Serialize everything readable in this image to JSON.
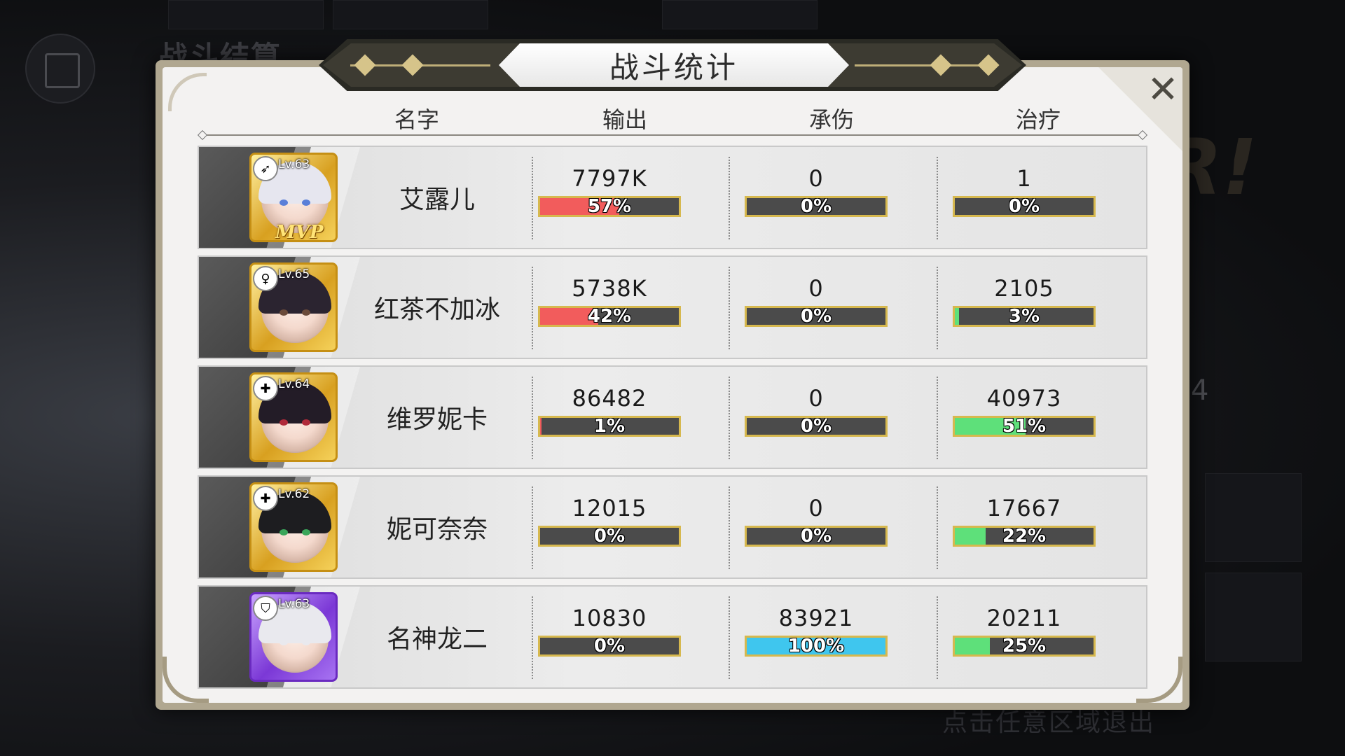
{
  "background": {
    "screen_title": "战斗结算",
    "exit_hint": "点击任意区域退出",
    "side_number": "4"
  },
  "dialog": {
    "title": "战斗统计",
    "close_icon": "close-icon",
    "columns": {
      "name": "名字",
      "damage": "输出",
      "tank": "承伤",
      "heal": "治疗"
    },
    "colors": {
      "damage": "#f25c5c",
      "tank": "#3fc6ee",
      "heal": "#5ee07a",
      "bar_bg": "#4b4b4b",
      "bar_border": "#d6b84e"
    }
  },
  "rows": [
    {
      "name": "艾露儿",
      "level": "Lv.63",
      "frame": "gold",
      "role_icon": "archer-icon",
      "mvp": "MVP",
      "damage": {
        "value": "7797K",
        "pct": "57%",
        "frac": 0.57
      },
      "tank": {
        "value": "0",
        "pct": "0%",
        "frac": 0
      },
      "heal": {
        "value": "1",
        "pct": "0%",
        "frac": 0
      },
      "hair": "#e6e6ef",
      "eye": "#5a7fd8"
    },
    {
      "name": "红茶不加冰",
      "level": "Lv.65",
      "frame": "gold",
      "role_icon": "mage-icon",
      "mvp": "",
      "damage": {
        "value": "5738K",
        "pct": "42%",
        "frac": 0.42
      },
      "tank": {
        "value": "0",
        "pct": "0%",
        "frac": 0
      },
      "heal": {
        "value": "2105",
        "pct": "3%",
        "frac": 0.03
      },
      "hair": "#2b2430",
      "eye": "#6a4a3a"
    },
    {
      "name": "维罗妮卡",
      "level": "Lv.64",
      "frame": "gold",
      "role_icon": "healer-icon",
      "mvp": "",
      "damage": {
        "value": "86482",
        "pct": "1%",
        "frac": 0.01
      },
      "tank": {
        "value": "0",
        "pct": "0%",
        "frac": 0
      },
      "heal": {
        "value": "40973",
        "pct": "51%",
        "frac": 0.51
      },
      "hair": "#231c27",
      "eye": "#b02a3a"
    },
    {
      "name": "妮可奈奈",
      "level": "Lv.62",
      "frame": "gold",
      "role_icon": "healer-icon",
      "mvp": "",
      "damage": {
        "value": "12015",
        "pct": "0%",
        "frac": 0
      },
      "tank": {
        "value": "0",
        "pct": "0%",
        "frac": 0
      },
      "heal": {
        "value": "17667",
        "pct": "22%",
        "frac": 0.22
      },
      "hair": "#1d1d20",
      "eye": "#3aa65a"
    },
    {
      "name": "名神龙二",
      "level": "Lv.63",
      "frame": "purple",
      "role_icon": "shield-icon",
      "mvp": "",
      "damage": {
        "value": "10830",
        "pct": "0%",
        "frac": 0
      },
      "tank": {
        "value": "83921",
        "pct": "100%",
        "frac": 1.0
      },
      "heal": {
        "value": "20211",
        "pct": "25%",
        "frac": 0.25
      },
      "hair": "#e9e9ee",
      "eye": "#e9e9ee"
    }
  ]
}
